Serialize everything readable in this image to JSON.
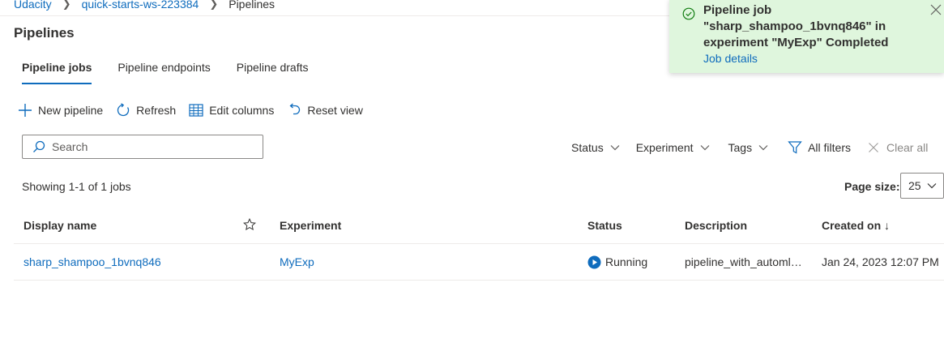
{
  "breadcrumb": [
    "Udacity",
    "quick-starts-ws-223384",
    "Pipelines"
  ],
  "page_title": "Pipelines",
  "tabs": [
    {
      "label": "Pipeline jobs",
      "active": true
    },
    {
      "label": "Pipeline endpoints",
      "active": false
    },
    {
      "label": "Pipeline drafts",
      "active": false
    }
  ],
  "toolbar": {
    "new_pipeline": "New pipeline",
    "refresh": "Refresh",
    "edit_columns": "Edit columns",
    "reset_view": "Reset view"
  },
  "search": {
    "placeholder": "Search"
  },
  "filters": {
    "status": "Status",
    "experiment": "Experiment",
    "tags": "Tags",
    "all_filters": "All filters",
    "clear_all": "Clear all"
  },
  "showing": "Showing 1-1 of 1 jobs",
  "page_size": {
    "label": "Page size:",
    "value": "25"
  },
  "table": {
    "columns": {
      "display_name": "Display name",
      "experiment": "Experiment",
      "status": "Status",
      "description": "Description",
      "created_on": "Created on ↓"
    },
    "rows": [
      {
        "display_name": "sharp_shampoo_1bvnq846",
        "experiment": "MyExp",
        "status": "Running",
        "description": "pipeline_with_automlst...",
        "created_on": "Jan 24, 2023 12:07 PM"
      }
    ]
  },
  "toast": {
    "message": "Pipeline job \"sharp_shampoo_1bvnq846\" in experiment \"MyExp\" Completed",
    "link": "Job details"
  },
  "colors": {
    "accent": "#0f6cbd",
    "toast_bg": "#dff6dd",
    "success": "#107c10"
  },
  "icons": {
    "new_pipeline": "plus-icon",
    "refresh": "refresh-icon",
    "edit_columns": "table-columns-icon",
    "reset_view": "undo-icon",
    "search": "search-icon",
    "filter": "filter-icon",
    "clear": "close-icon",
    "status": "running-play-icon",
    "favorite": "star-icon",
    "toast_status": "checkmark-circle-icon"
  }
}
